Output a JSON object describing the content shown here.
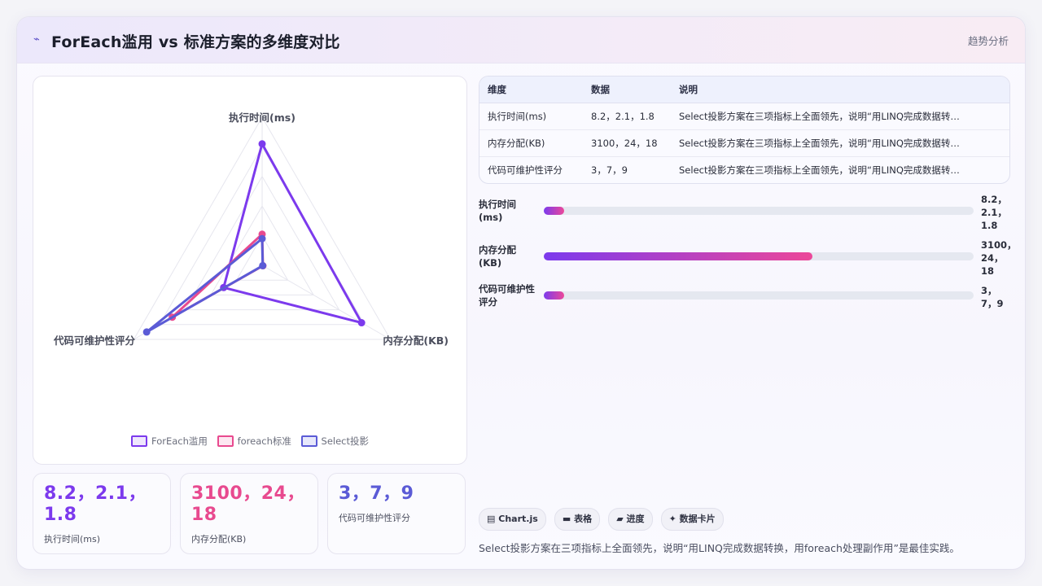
{
  "header": {
    "icon": "chart-trend-icon",
    "icon_glyph": "⌁",
    "title": "ForEach滥用 vs 标准方案的多维度对比",
    "tag": "趋势分析"
  },
  "colors": {
    "purple": "#7c3aed",
    "pink": "#e84a8f",
    "indigo": "#5b5bd6",
    "grid": "#e6e6ee"
  },
  "chart_data": {
    "type": "radar",
    "axes": [
      "执行时间(ms)",
      "内存分配(KB)",
      "代码可维护性评分"
    ],
    "axis_max": [
      10,
      4000,
      10
    ],
    "series": [
      {
        "name": "ForEach滥用",
        "values": [
          8.2,
          3100,
          3
        ],
        "color": "#7c3aed"
      },
      {
        "name": "foreach标准",
        "values": [
          2.1,
          24,
          7
        ],
        "color": "#e84a8f"
      },
      {
        "name": "Select投影",
        "values": [
          1.8,
          18,
          9
        ],
        "color": "#5b5bd6"
      }
    ],
    "grid_levels": 5,
    "legend_position": "bottom"
  },
  "stats": [
    {
      "value": "8.2，2.1，1.8",
      "label": "执行时间(ms)",
      "color": "#7c3aed"
    },
    {
      "value": "3100，24，18",
      "label": "内存分配(KB)",
      "color": "#e84a8f"
    },
    {
      "value": "3，7，9",
      "label": "代码可维护性评分",
      "color": "#5b5bd6"
    }
  ],
  "table": {
    "headers": [
      "维度",
      "数据",
      "说明"
    ],
    "rows": [
      [
        "执行时间(ms)",
        "8.2，2.1，1.8",
        "Select投影方案在三项指标上全面领先，说明“用LINQ完成数据转…"
      ],
      [
        "内存分配(KB)",
        "3100，24，18",
        "Select投影方案在三项指标上全面领先，说明“用LINQ完成数据转…"
      ],
      [
        "代码可维护性评分",
        "3，7，9",
        "Select投影方案在三项指标上全面领先，说明“用LINQ完成数据转…"
      ]
    ]
  },
  "progress": [
    {
      "name": "执行时间\n(ms)",
      "value": "8.2，\n2.1，\n1.8",
      "fraction": 0.048
    },
    {
      "name": "内存分配\n(KB)",
      "value": "3100，\n24，\n18",
      "fraction": 0.625
    },
    {
      "name": "代码可维护性\n评分",
      "value": "3，\n7，9",
      "fraction": 0.048
    }
  ],
  "chips": [
    {
      "icon": "chart-icon",
      "glyph": "▤",
      "label": "Chart.js"
    },
    {
      "icon": "table-icon",
      "glyph": "▬",
      "label": "表格"
    },
    {
      "icon": "progress-icon",
      "glyph": "▰",
      "label": "进度"
    },
    {
      "icon": "sparkle-icon",
      "glyph": "✦",
      "label": "数据卡片"
    }
  ],
  "summary": "Select投影方案在三项指标上全面领先，说明“用LINQ完成数据转换，用foreach处理副作用”是最佳实践。"
}
